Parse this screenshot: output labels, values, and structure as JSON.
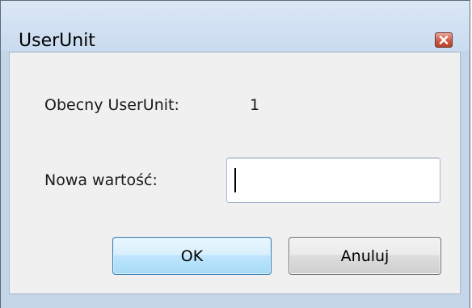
{
  "window": {
    "title": "UserUnit",
    "close_icon": "close-icon"
  },
  "current": {
    "label": "Obecny UserUnit:",
    "value": "1"
  },
  "new_value": {
    "label": "Nowa wartość:",
    "value": "",
    "placeholder": ""
  },
  "buttons": {
    "ok": "OK",
    "cancel": "Anuluj"
  },
  "colors": {
    "frame": "#c4d5e8",
    "client": "#f0f0f0",
    "default_button_border": "#3c7fb1",
    "close_button": "#cf5a45"
  }
}
